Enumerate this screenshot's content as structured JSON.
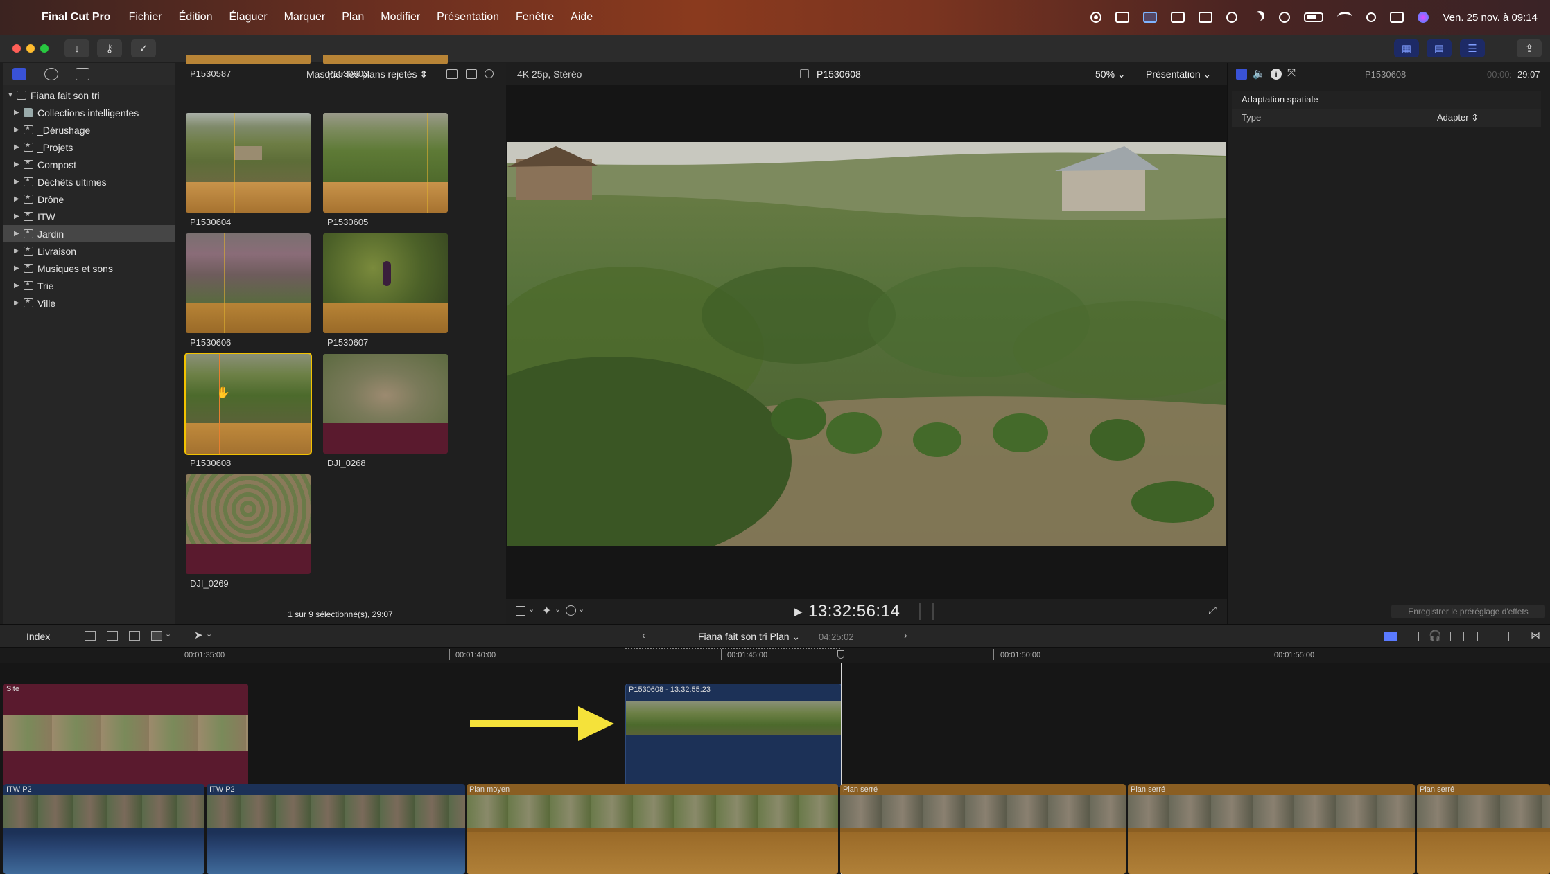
{
  "menubar": {
    "app_name": "Final Cut Pro",
    "menus": [
      "Fichier",
      "Édition",
      "Élaguer",
      "Marquer",
      "Plan",
      "Modifier",
      "Présentation",
      "Fenêtre",
      "Aide"
    ],
    "clock": "Ven. 25 nov. à 09:14"
  },
  "sidebar": {
    "library": "Fiana fait son tri",
    "items": [
      {
        "label": "Collections intelligentes",
        "icon": "folder-icon"
      },
      {
        "label": "_Dérushage",
        "icon": "event-star-icon"
      },
      {
        "label": "_Projets",
        "icon": "event-star-icon"
      },
      {
        "label": "Compost",
        "icon": "event-star-icon"
      },
      {
        "label": "Déchêts ultimes",
        "icon": "event-star-icon"
      },
      {
        "label": "Drône",
        "icon": "event-star-icon"
      },
      {
        "label": "ITW",
        "icon": "event-star-icon"
      },
      {
        "label": "Jardin",
        "icon": "event-star-icon",
        "selected": true
      },
      {
        "label": "Livraison",
        "icon": "event-star-icon"
      },
      {
        "label": "Musiques et sons",
        "icon": "event-star-icon"
      },
      {
        "label": "Trie",
        "icon": "event-star-icon"
      },
      {
        "label": "Ville",
        "icon": "event-star-icon"
      }
    ]
  },
  "browser": {
    "filter": "Masquer les plans rejetés",
    "clips": [
      {
        "name": "P1530587"
      },
      {
        "name": "P1530603"
      },
      {
        "name": "P1530604"
      },
      {
        "name": "P1530605"
      },
      {
        "name": "P1530606"
      },
      {
        "name": "P1530607"
      },
      {
        "name": "P1530608",
        "selected": true
      },
      {
        "name": "DJI_0268"
      },
      {
        "name": "DJI_0269"
      }
    ],
    "status": "1 sur 9 sélectionné(s), 29:07"
  },
  "viewer": {
    "format": "4K 25p, Stéréo",
    "clip_name": "P1530608",
    "zoom": "50%",
    "presentation": "Présentation",
    "timecode": "13:32:56:14"
  },
  "inspector": {
    "clip_name": "P1530608",
    "time_dim": "00:00:",
    "time": "29:07",
    "section": "Adaptation spatiale",
    "type_label": "Type",
    "type_value": "Adapter",
    "save_preset": "Enregistrer le préréglage d'effets"
  },
  "timeline": {
    "index": "Index",
    "project": "Fiana fait son tri Plan",
    "duration": "04:25:02",
    "ruler": [
      "00:01:35:00",
      "00:01:40:00",
      "00:01:45:00",
      "00:01:50:00",
      "00:01:55:00"
    ],
    "clips": {
      "site": "Site",
      "connected": "P1530608 - 13:32:55:23",
      "itw1": "ITW P2",
      "itw2": "ITW P2",
      "moyen": "Plan moyen",
      "serre1": "Plan serré",
      "serre2": "Plan serré",
      "serre3": "Plan serré"
    }
  },
  "colors": {
    "selection": "#f2c200",
    "audio_orange": "#b88436",
    "drone_magenta": "#5a1a2e",
    "video_blue": "#1c3157",
    "accent_blue": "#6f8cff",
    "arrow_yellow": "#f5e23a"
  }
}
